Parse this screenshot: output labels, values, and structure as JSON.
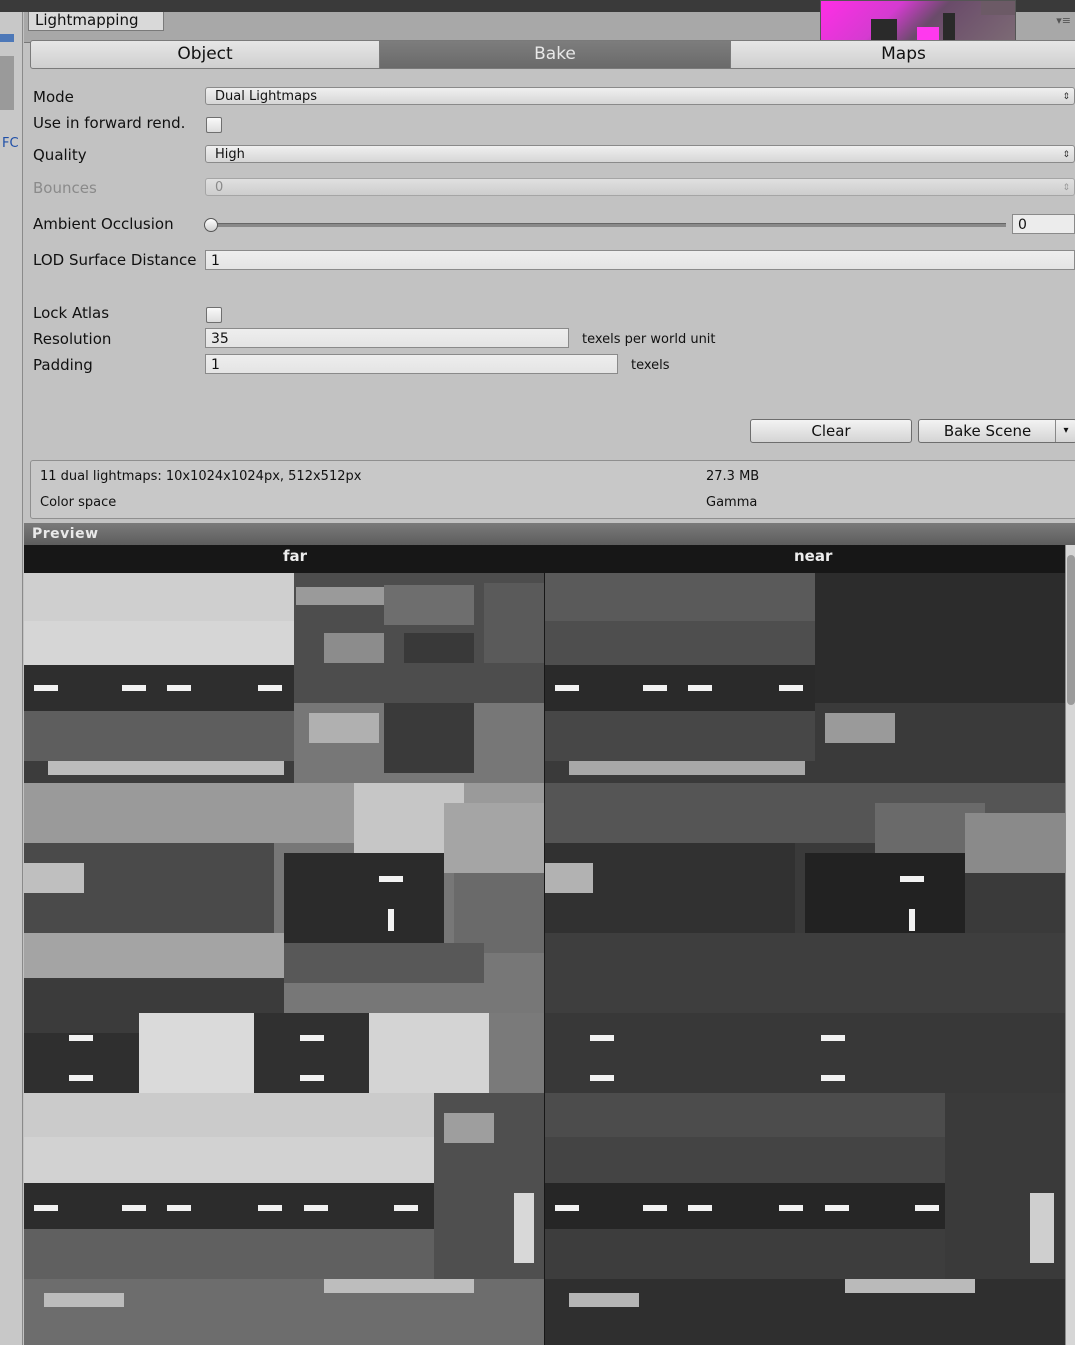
{
  "window": {
    "tab_title": "Lightmapping",
    "tab_menu_glyph": "▾≡",
    "left_strip_text": "FC"
  },
  "tabs": {
    "object": "Object",
    "bake": "Bake",
    "maps": "Maps"
  },
  "settings": {
    "mode_label": "Mode",
    "mode_value": "Dual Lightmaps",
    "forward_label": "Use in forward rend.",
    "forward_checked": false,
    "quality_label": "Quality",
    "quality_value": "High",
    "bounces_label": "Bounces",
    "bounces_value": "0",
    "ao_label": "Ambient Occlusion",
    "ao_value": "0",
    "lod_label": "LOD Surface Distance",
    "lod_value": "1",
    "lock_atlas_label": "Lock Atlas",
    "lock_atlas_checked": false,
    "resolution_label": "Resolution",
    "resolution_value": "35",
    "resolution_unit": "texels per world unit",
    "padding_label": "Padding",
    "padding_value": "1",
    "padding_unit": "texels"
  },
  "actions": {
    "clear": "Clear",
    "bake_scene": "Bake Scene",
    "dropdown_glyph": "▾"
  },
  "info": {
    "lightmaps": "11 dual lightmaps: 10x1024x1024px, 512x512px",
    "size": "27.3 MB",
    "color_space_label": "Color space",
    "color_space_value": "Gamma"
  },
  "preview": {
    "title": "Preview",
    "far_label": "far",
    "near_label": "near"
  },
  "colors": {
    "panel_bg": "#c2c2c2",
    "active_tab": "#6f6f6f",
    "thumb_magenta": "#ff2ee6"
  }
}
